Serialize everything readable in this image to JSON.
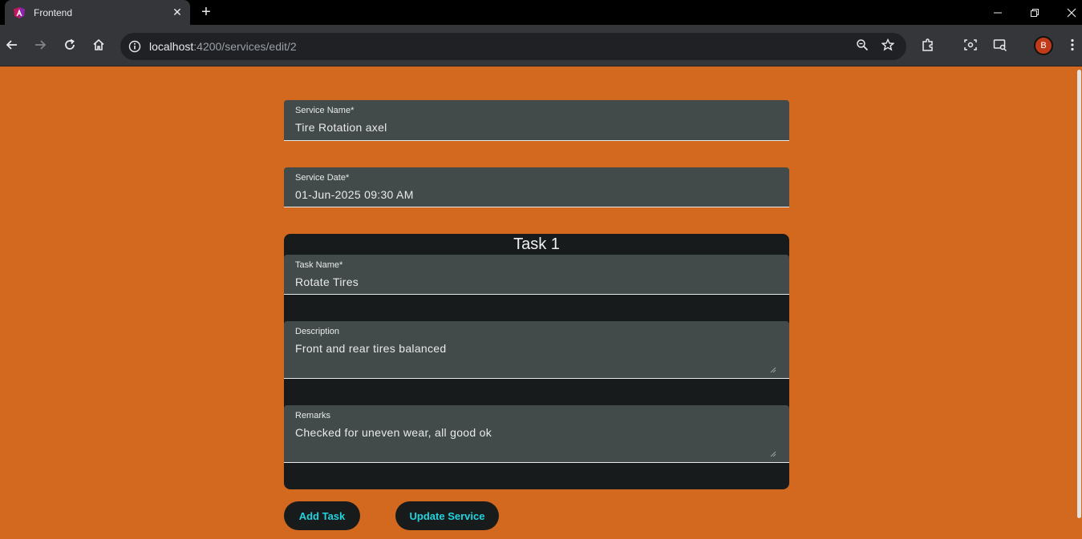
{
  "browser": {
    "tab_title": "Frontend",
    "url_host": "localhost",
    "url_path": ":4200/services/edit/2",
    "profile_initial": "B"
  },
  "form": {
    "service_name": {
      "label": "Service Name*",
      "value": "Tire Rotation axel"
    },
    "service_date": {
      "label": "Service Date*",
      "value": "01-Jun-2025 09:30 AM"
    }
  },
  "task": {
    "title": "Task 1",
    "name": {
      "label": "Task Name*",
      "value": "Rotate Tires"
    },
    "description": {
      "label": "Description",
      "value": "Front and rear tires balanced"
    },
    "remarks": {
      "label": "Remarks",
      "value": "Checked for uneven wear, all good ok"
    }
  },
  "buttons": {
    "add_task": "Add Task",
    "update_service": "Update Service"
  },
  "colors": {
    "page_bg": "#d2691e",
    "field_bg": "#424a4a",
    "card_bg": "#181b1c",
    "button_text": "#22d3dd"
  }
}
